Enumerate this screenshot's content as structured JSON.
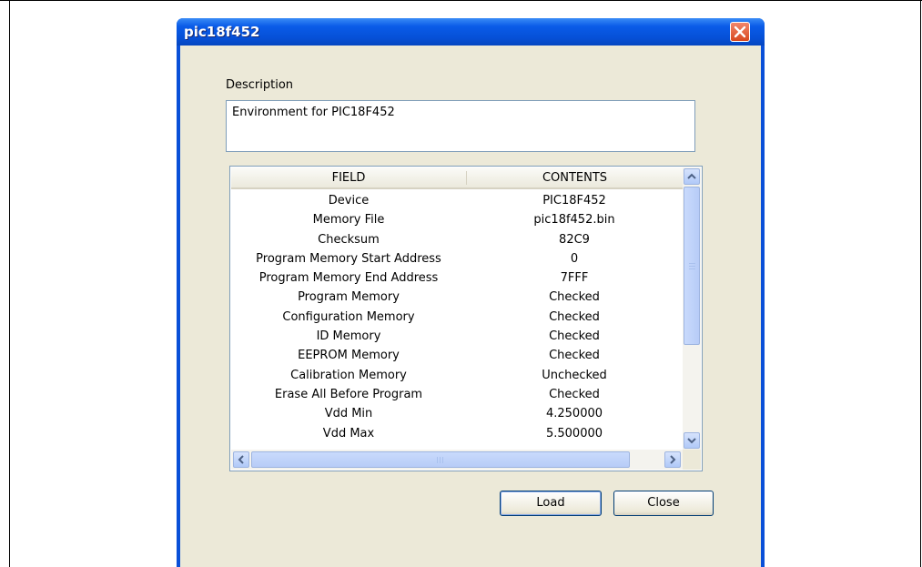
{
  "window": {
    "title": "pic18f452"
  },
  "description": {
    "label": "Description",
    "value": "Environment for PIC18F452"
  },
  "table": {
    "headers": [
      "FIELD",
      "CONTENTS"
    ],
    "rows": [
      [
        "Device",
        "PIC18F452"
      ],
      [
        "Memory File",
        "pic18f452.bin"
      ],
      [
        "Checksum",
        "82C9"
      ],
      [
        "Program Memory Start Address",
        "0"
      ],
      [
        "Program Memory End Address",
        "7FFF"
      ],
      [
        "Program Memory",
        "Checked"
      ],
      [
        "Configuration Memory",
        "Checked"
      ],
      [
        "ID Memory",
        "Checked"
      ],
      [
        "EEPROM Memory",
        "Checked"
      ],
      [
        "Calibration Memory",
        "Unchecked"
      ],
      [
        "Erase All Before Program",
        "Checked"
      ],
      [
        "Vdd Min",
        "4.250000"
      ],
      [
        "Vdd Max",
        "5.500000"
      ]
    ]
  },
  "buttons": {
    "load": "Load",
    "close": "Close"
  },
  "colors": {
    "titlebar": "#0a5be8",
    "dialog_bg": "#ece9d8",
    "scroll_thumb": "#c9dafc"
  }
}
